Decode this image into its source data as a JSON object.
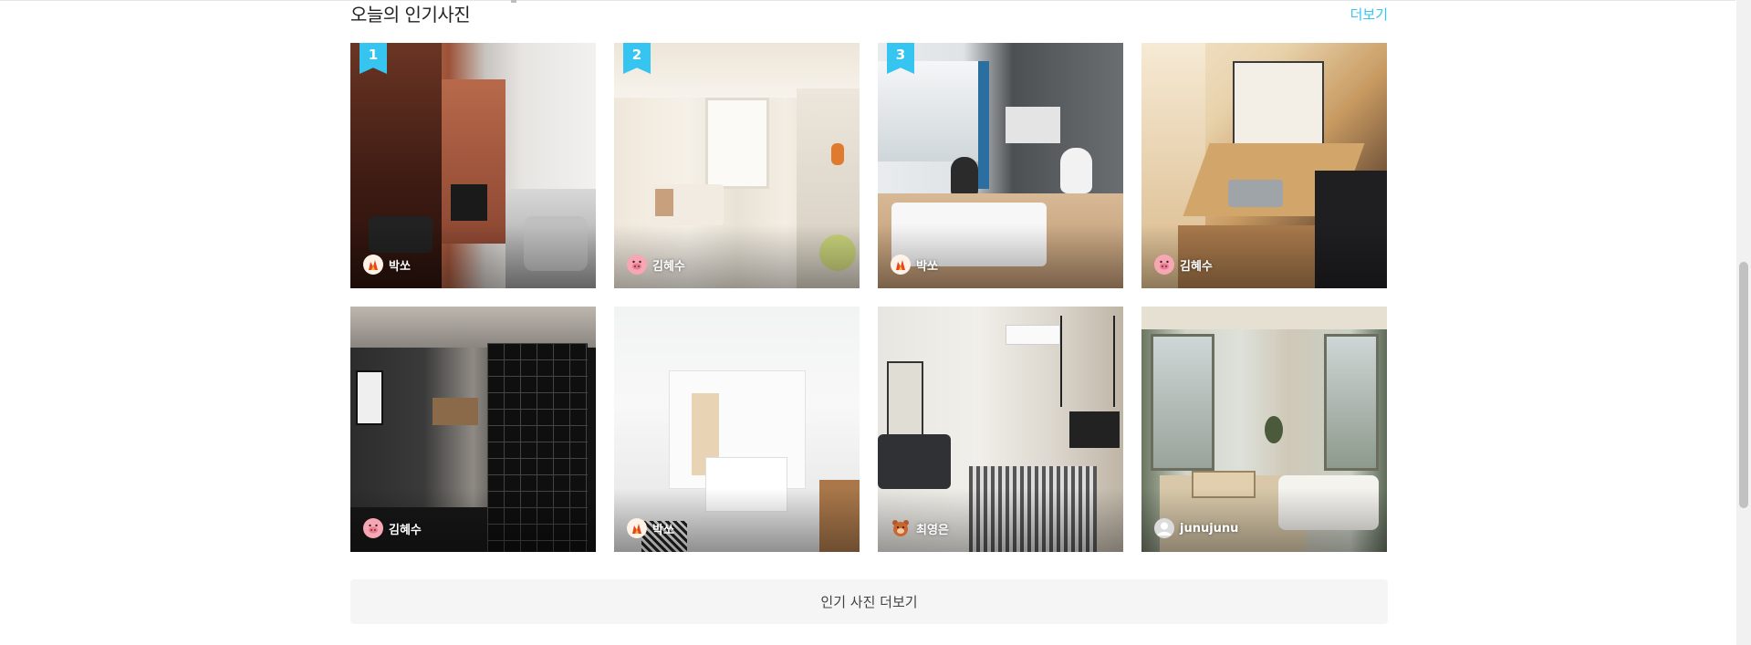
{
  "section": {
    "title": "오늘의 인기사진",
    "more_link": "더보기",
    "load_more_button": "인기 사진 더보기"
  },
  "colors": {
    "accent": "#35c5f0",
    "button_bg": "#f5f5f5"
  },
  "photos": [
    {
      "rank": "1",
      "author": "박쏘",
      "avatar_icon": "fire-avatar-icon"
    },
    {
      "rank": "2",
      "author": "김혜수",
      "avatar_icon": "pig-avatar-icon"
    },
    {
      "rank": "3",
      "author": "박쏘",
      "avatar_icon": "fire-avatar-icon"
    },
    {
      "rank": "",
      "author": "김혜수",
      "avatar_icon": "pig-avatar-icon"
    },
    {
      "rank": "",
      "author": "김혜수",
      "avatar_icon": "pig-avatar-icon"
    },
    {
      "rank": "",
      "author": "박쏘",
      "avatar_icon": "fire-avatar-icon"
    },
    {
      "rank": "",
      "author": "최영은",
      "avatar_icon": "bear-avatar-icon"
    },
    {
      "rank": "",
      "author": "junujunu",
      "avatar_icon": "default-user-avatar-icon"
    }
  ]
}
